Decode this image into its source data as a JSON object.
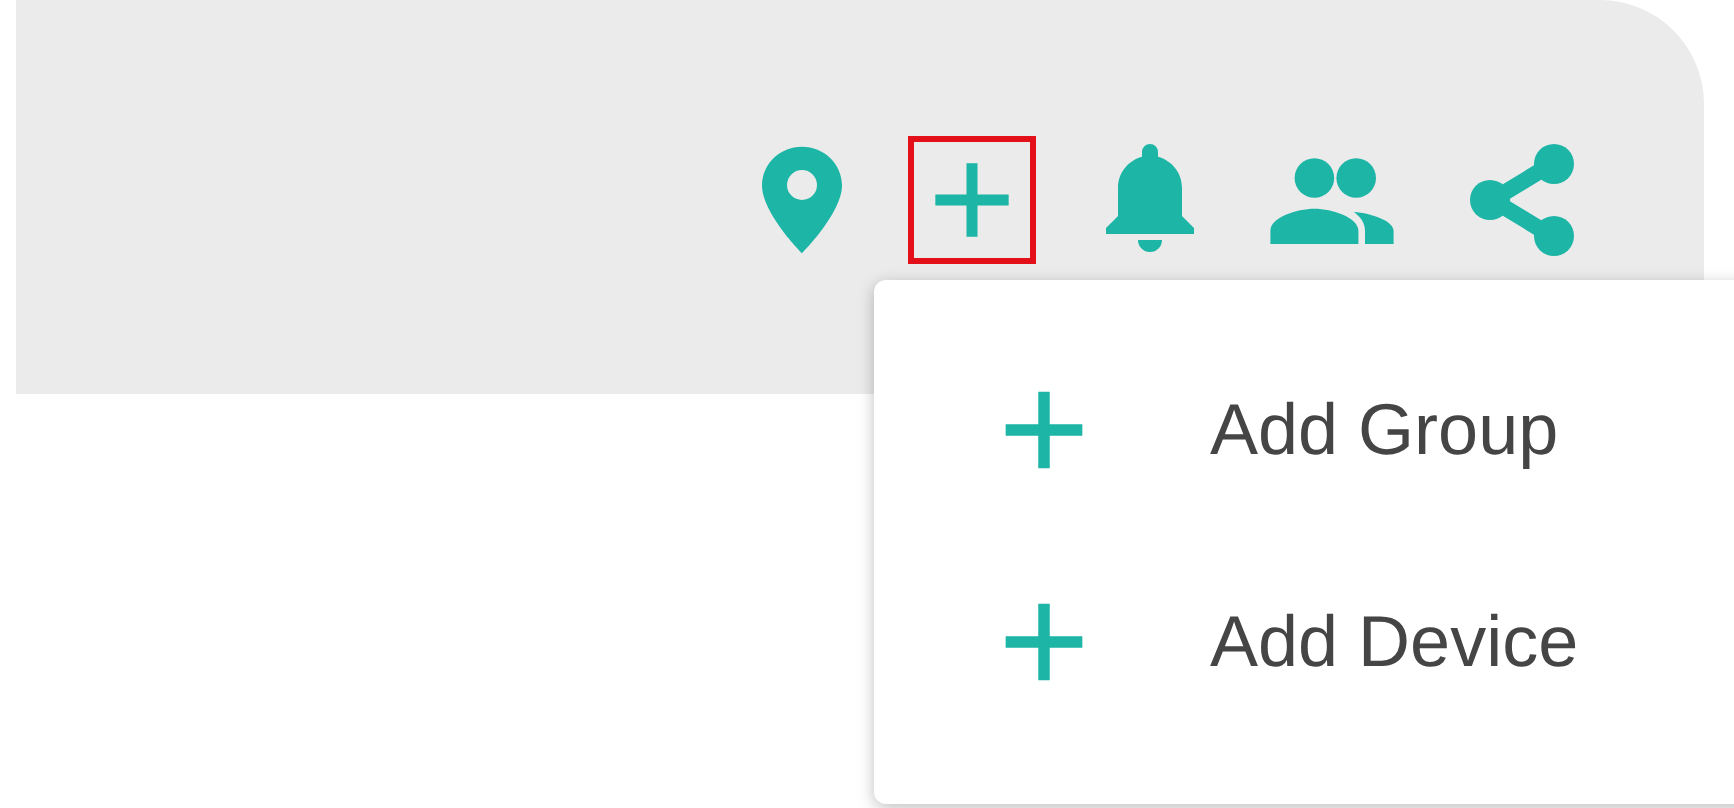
{
  "toolbar": [
    {
      "kind": "pin",
      "selected": false
    },
    {
      "kind": "plus",
      "selected": true
    },
    {
      "kind": "bell",
      "selected": false
    },
    {
      "kind": "people",
      "selected": false
    },
    {
      "kind": "share",
      "selected": false
    }
  ],
  "menu": [
    {
      "label": "Add Group"
    },
    {
      "label": "Add Device"
    }
  ]
}
